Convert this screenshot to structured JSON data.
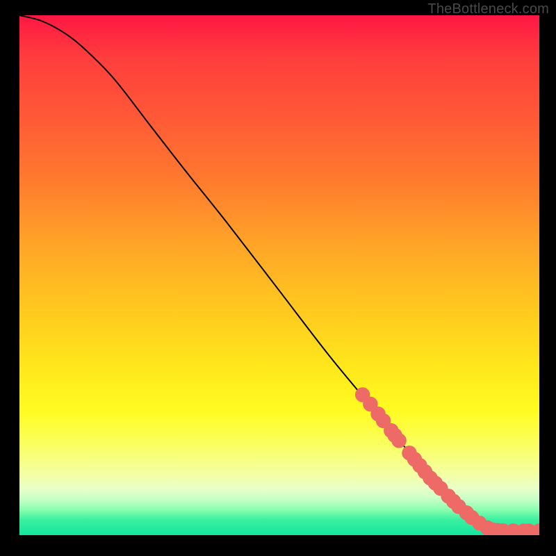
{
  "watermark": "TheBottleneck.com",
  "colors": {
    "curve": "#000000",
    "marker": "#ed6a66",
    "gradient_top": "#ff1744",
    "gradient_bottom": "#12e6a0",
    "frame": "#000000"
  },
  "chart_data": {
    "type": "line",
    "title": "",
    "xlabel": "",
    "ylabel": "",
    "xlim": [
      0,
      100
    ],
    "ylim": [
      0,
      100
    ],
    "curve": {
      "x": [
        0,
        4,
        8,
        12,
        18,
        25,
        32,
        40,
        50,
        60,
        70,
        80,
        88,
        92,
        96,
        100
      ],
      "y": [
        100,
        99,
        97,
        94,
        88,
        79,
        70,
        60,
        47,
        34,
        22,
        10,
        3,
        1.5,
        0.9,
        0.8
      ]
    },
    "markers": [
      {
        "x": 66,
        "y": 27
      },
      {
        "x": 67.5,
        "y": 25.2
      },
      {
        "x": 69,
        "y": 23.3
      },
      {
        "x": 70,
        "y": 22.0
      },
      {
        "x": 71.5,
        "y": 20.1
      },
      {
        "x": 72.2,
        "y": 19.2
      },
      {
        "x": 73,
        "y": 18.2
      },
      {
        "x": 75,
        "y": 15.8
      },
      {
        "x": 76,
        "y": 14.6
      },
      {
        "x": 77,
        "y": 13.4
      },
      {
        "x": 78,
        "y": 12.2
      },
      {
        "x": 79,
        "y": 11.0
      },
      {
        "x": 80,
        "y": 10.0
      },
      {
        "x": 81,
        "y": 9.0
      },
      {
        "x": 82.5,
        "y": 7.5
      },
      {
        "x": 83.5,
        "y": 6.5
      },
      {
        "x": 84.5,
        "y": 5.5
      },
      {
        "x": 86,
        "y": 4.3
      },
      {
        "x": 87,
        "y": 3.4
      },
      {
        "x": 88.5,
        "y": 2.3
      },
      {
        "x": 90,
        "y": 1.4
      },
      {
        "x": 91,
        "y": 1.0
      },
      {
        "x": 92,
        "y": 0.9
      },
      {
        "x": 93,
        "y": 0.85
      },
      {
        "x": 95,
        "y": 0.82
      },
      {
        "x": 97,
        "y": 0.81
      },
      {
        "x": 98,
        "y": 0.8
      },
      {
        "x": 100,
        "y": 0.8
      }
    ],
    "marker_radius": 7
  }
}
